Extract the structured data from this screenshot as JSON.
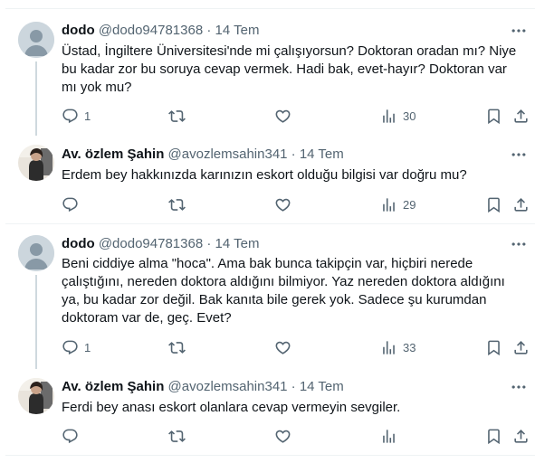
{
  "tweets": [
    {
      "name": "dodo",
      "handle": "@dodo94781368",
      "dot": "·",
      "time": "14 Tem",
      "text": "Üstad, İngiltere Üniversitesi'nde mi çalışıyorsun? Doktoran oradan mı? Niye\nbu kadar zor bu soruya cevap vermek. Hadi bak, evet-hayır? Doktoran var\nmı yok mu?",
      "reply_count": "1",
      "views": "30"
    },
    {
      "name": "Av. özlem Şahin",
      "handle": "@avozlemsahin341",
      "dot": "·",
      "time": "14 Tem",
      "text": "Erdem bey hakkınızda karınızın eskort olduğu bilgisi var doğru mu?",
      "reply_count": "",
      "views": "29"
    },
    {
      "name": "dodo",
      "handle": "@dodo94781368",
      "dot": "·",
      "time": "14 Tem",
      "text": "Beni ciddiye alma \"hoca\". Ama bak bunca takipçin var, hiçbiri nerede\nçalıştığını, nereden doktora aldığını bilmiyor. Yaz nereden doktora aldığını\nya, bu kadar zor değil. Bak kanıta bile gerek yok. Sadece şu kurumdan\ndoktoram var de, geç. Evet?",
      "reply_count": "1",
      "views": "33"
    },
    {
      "name": "Av. özlem Şahin",
      "handle": "@avozlemsahin341",
      "dot": "·",
      "time": "14 Tem",
      "text": "Ferdi bey anası eskort olanlara cevap vermeyin sevgiler.",
      "reply_count": "",
      "views": ""
    }
  ],
  "icons": {
    "more": "more-horizontal-icon",
    "reply": "reply-icon",
    "retweet": "retweet-icon",
    "like": "like-icon",
    "views": "views-icon",
    "bookmark": "bookmark-icon",
    "share": "share-icon"
  },
  "colors": {
    "text": "#0f1419",
    "secondary": "#536471",
    "divider": "#eff3f4",
    "thread_line": "#cfd9de"
  }
}
